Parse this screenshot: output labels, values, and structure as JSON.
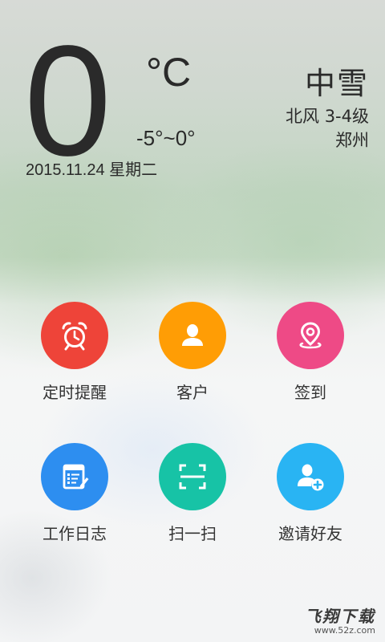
{
  "weather": {
    "temperature": "0",
    "unit": "°C",
    "range": "-5°~0°",
    "date": "2015.11.24 星期二",
    "condition": "中雪",
    "wind": "北风 3-4级",
    "city": "郑州"
  },
  "actions": [
    {
      "label": "定时提醒",
      "icon": "alarm-clock-icon",
      "color": "#ee4439"
    },
    {
      "label": "客户",
      "icon": "person-icon",
      "color": "#ff9d05"
    },
    {
      "label": "签到",
      "icon": "location-pin-icon",
      "color": "#ee4a86"
    },
    {
      "label": "工作日志",
      "icon": "document-edit-icon",
      "color": "#2d8ef0"
    },
    {
      "label": "扫一扫",
      "icon": "scan-icon",
      "color": "#17c3a6"
    },
    {
      "label": "邀请好友",
      "icon": "add-person-icon",
      "color": "#29b4f3"
    }
  ],
  "watermark": {
    "title": "飞翔下载",
    "url": "www.52z.com"
  }
}
